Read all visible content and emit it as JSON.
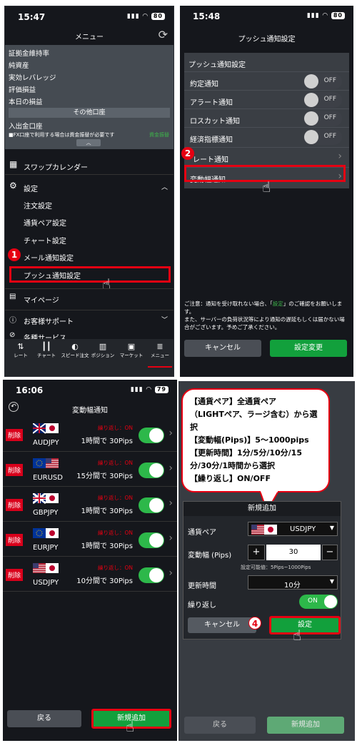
{
  "s1": {
    "time": "15:47",
    "battery": "80",
    "title": "メニュー",
    "items": [
      "証拠金維持率",
      "純資産",
      "実効レバレッジ",
      "評価損益",
      "本日の損益"
    ],
    "other_header": "その他口座",
    "deposit": "入出金口座",
    "note": "■FX口座で利用する場合は資金振替が必要です",
    "note_link": "資金振替",
    "swap": "スワップカレンダー",
    "settings": "設定",
    "sub": [
      "注文設定",
      "通貨ペア設定",
      "チャート設定",
      "メール通知設定",
      "プッシュ通知設定"
    ],
    "mypage": "マイページ",
    "support": "お客様サポート",
    "services": "各種サービス",
    "tabs": [
      "レート",
      "チャート",
      "スピード注文",
      "ポジション",
      "マーケット",
      "メニュー"
    ],
    "step": "1"
  },
  "s2": {
    "time": "15:48",
    "battery": "80",
    "title": "プッシュ通知設定",
    "section": "プッシュ通知設定",
    "toggles": [
      {
        "label": "約定通知",
        "state": "OFF"
      },
      {
        "label": "アラート通知",
        "state": "OFF"
      },
      {
        "label": "ロスカット通知",
        "state": "OFF"
      },
      {
        "label": "経済指標通知",
        "state": "OFF"
      }
    ],
    "rate": "レート通知",
    "change": "変動幅通知",
    "step": "2",
    "caution_a": "ご注意：通知を受け取れない場合、「",
    "caution_link": "設定",
    "caution_b": "」のご確認をお願いします。\nまた、サーバーの負荷状況等により通知の遅延もしくは届かない場合がございます。予めご了承ください。",
    "cancel": "キャンセル",
    "submit": "設定変更"
  },
  "s3": {
    "time": "16:06",
    "battery": "79",
    "title": "変動幅通知",
    "delete": "削除",
    "repeat": "繰り返し：ON",
    "rows": [
      {
        "pair": "AUDJPY",
        "period": "1時間で 30Pips"
      },
      {
        "pair": "EURUSD",
        "period": "15分間で 30Pips"
      },
      {
        "pair": "GBPJPY",
        "period": "1時間で 30Pips"
      },
      {
        "pair": "EURJPY",
        "period": "1時間で 30Pips"
      },
      {
        "pair": "USDJPY",
        "period": "10分間で 30Pips"
      }
    ],
    "back": "戻る",
    "add": "新規追加"
  },
  "s4": {
    "bubble": [
      "【通貨ペア】全通貨ペア",
      "（LIGHTペア、ラージ含む）から選択",
      "【変動幅(Pips)】5～1000pips",
      "【更新時間】1分/5分/10分/15分/30分/1時間から選択",
      "【繰り返し】ON/OFF"
    ],
    "dialog_title": "新規追加",
    "pair_label": "通貨ペア",
    "pair": "USDJPY",
    "range_label": "変動幅 (Pips)",
    "minus": "−",
    "plus": "+",
    "range_value": "30",
    "range_hint": "設定可能値：5Pips~1000Pips",
    "time_label": "更新時間",
    "time_value": "10分",
    "repeat_label": "繰り返し",
    "repeat_value": "ON",
    "cancel": "キャンセル",
    "submit": "設定",
    "step": "4",
    "back": "戻る",
    "add": "新規追加"
  }
}
